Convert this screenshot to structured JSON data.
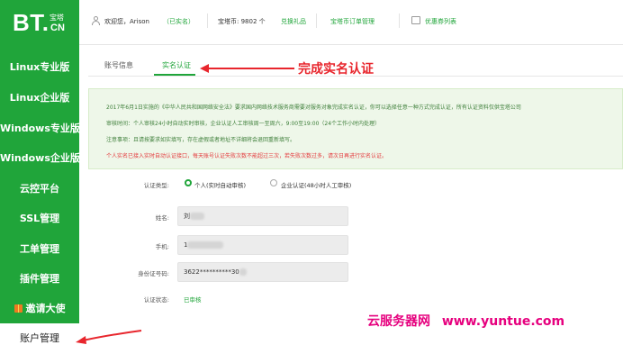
{
  "logo": {
    "text": "BT.",
    "cn_top": "宝塔",
    "cn_bot": "CN"
  },
  "sidebar": {
    "items": [
      {
        "label": "Linux专业版"
      },
      {
        "label": "Linux企业版"
      },
      {
        "label": "Windows专业版"
      },
      {
        "label": "Windows企业版"
      },
      {
        "label": "云控平台"
      },
      {
        "label": "SSL管理"
      },
      {
        "label": "工单管理"
      },
      {
        "label": "插件管理"
      },
      {
        "label": "邀请大使",
        "icon": "gift-icon"
      },
      {
        "label": "账户管理",
        "active": true
      }
    ]
  },
  "header": {
    "welcome": "欢迎您，Arison",
    "verified": "（已实名）",
    "coins_label": "宝塔币: 9802 个",
    "exchange": "兑换礼品",
    "orders": "宝塔币订单管理",
    "coupons": "优惠券列表"
  },
  "tabs": [
    {
      "label": "账号信息",
      "active": false
    },
    {
      "label": "实名认证",
      "active": true
    }
  ],
  "annotations": {
    "complete": "完成实名认证",
    "color": "#e8262d"
  },
  "notice": {
    "lines": [
      "2017年6月1日实施的《中华人民共和国网络安全法》要求国内网络技术服务商需要对服务对象完成实名认证，你可以选择任意一种方式完成认证，所有认证资料仅供宝塔公司",
      "审核时间：个人审核24小时自动实时审核，企业认证人工审核周一至周六，9:00至19:00（24个工作小时内处理）",
      "注意事项：且请按要求如实填写，存在虚假或者地址不详细将会退回重新填写。",
      "个人实名已接入实时自动认证接口，每天账号认证失败次数不能超过三次，若失败次数过多，请次日再进行实名认证。"
    ]
  },
  "form": {
    "type_label": "认证类型:",
    "type_personal": "个人(实时自动审核)",
    "type_company": "企业认证(48小时人工审核)",
    "name_label": "姓名:",
    "name_value": "刘",
    "phone_label": "手机:",
    "phone_value": "1",
    "id_label": "身份证号码:",
    "id_value": "3622**********30",
    "status_label": "认证状态:",
    "status_value": "已审核"
  },
  "watermark": {
    "cn": "云服务器网",
    "url": "www.yuntue.com"
  },
  "colors": {
    "brand_green": "#20a53a",
    "notice_bg": "#eef7e9",
    "notice_text": "#3e7f3a",
    "warning_red": "#e4393c",
    "watermark_pink": "#e6007e",
    "link_green": "#20a53a"
  }
}
